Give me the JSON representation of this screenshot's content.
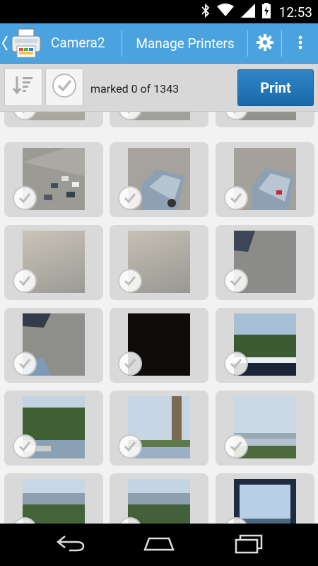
{
  "status_bar": {
    "time": "12:53"
  },
  "action_bar": {
    "title": "Camera2",
    "menu_label": "Manage Printers"
  },
  "toolbar": {
    "marked_text": "marked 0 of 1343",
    "print_label": "Print"
  },
  "grid": {
    "rows": [
      [
        "parking-edge",
        "parking-edge",
        "parking-edge"
      ],
      [
        "parking-lot-cars",
        "suv-top-view",
        "suv-top-view"
      ],
      [
        "empty-lot",
        "empty-lot",
        "lot-car-corner"
      ],
      [
        "lot-car-bottom",
        "dark-frame",
        "trees-sky"
      ],
      [
        "trees-water",
        "tower-sky",
        "sky-water"
      ],
      [
        "sky-trees",
        "sky-trees",
        "window-sky"
      ]
    ]
  },
  "colors": {
    "action_bar": "#4aa3df",
    "print_button": "#1f74b8",
    "toolbar": "#d8d8d8"
  }
}
